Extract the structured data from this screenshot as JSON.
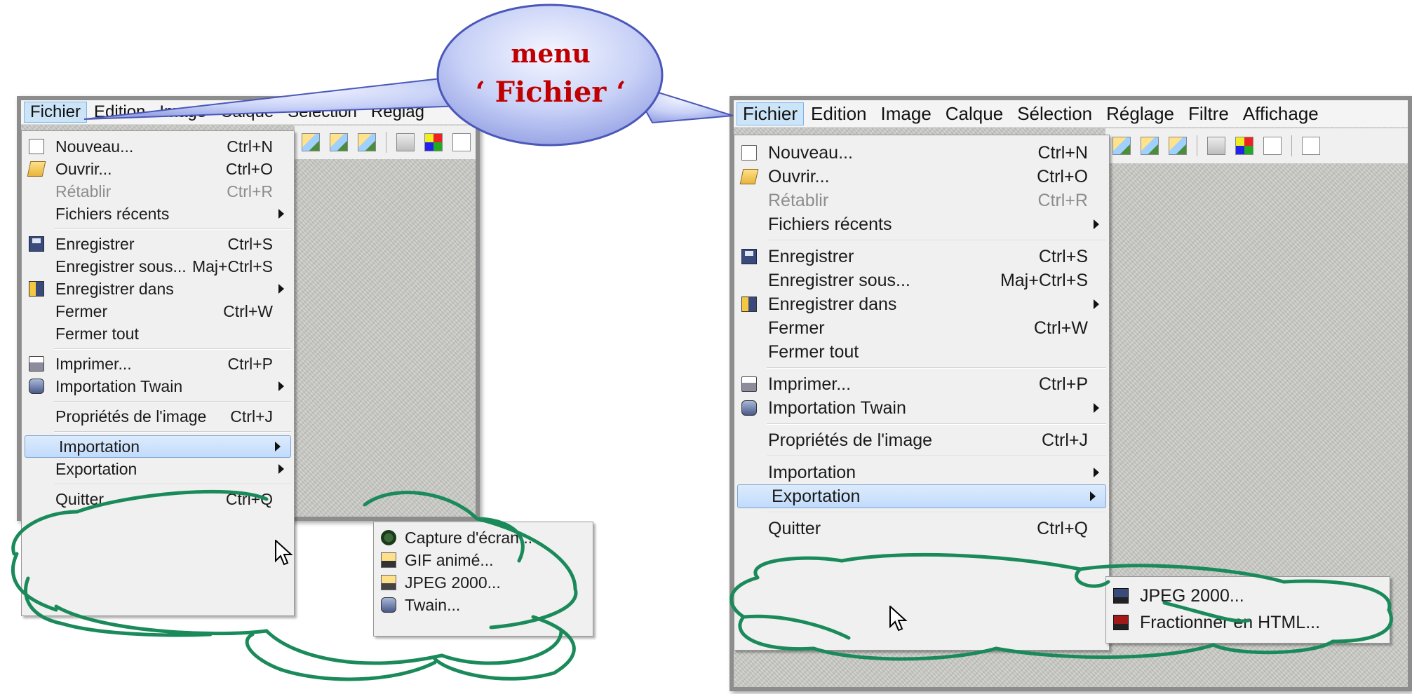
{
  "menubar": [
    "Fichier",
    "Edition",
    "Image",
    "Calque",
    "Sélection",
    "Réglage",
    "Filtre",
    "Affichage"
  ],
  "menubar_left_visible": [
    "Fichier",
    "Edition",
    "Image",
    "Calque",
    "Sélection",
    "Réglag"
  ],
  "callout": {
    "line1": "menu",
    "line2": "‘ Fichier ‘"
  },
  "file_menu": {
    "items": [
      {
        "label": "Nouveau...",
        "shortcut": "Ctrl+N",
        "icon": "new-document-icon"
      },
      {
        "label": "Ouvrir...",
        "shortcut": "Ctrl+O",
        "icon": "open-folder-icon"
      },
      {
        "label": "Rétablir",
        "shortcut": "Ctrl+R",
        "disabled": true
      },
      {
        "label": "Fichiers récents",
        "submenu": true
      },
      {
        "label": "Enregistrer",
        "shortcut": "Ctrl+S",
        "icon": "save-icon"
      },
      {
        "label": "Enregistrer sous...",
        "shortcut": "Maj+Ctrl+S"
      },
      {
        "label": "Enregistrer dans",
        "submenu": true,
        "icon": "save-in-icon"
      },
      {
        "label": "Fermer",
        "shortcut": "Ctrl+W"
      },
      {
        "label": "Fermer tout"
      },
      {
        "label": "Imprimer...",
        "shortcut": "Ctrl+P",
        "icon": "print-icon"
      },
      {
        "label": "Importation Twain",
        "submenu": true,
        "icon": "twain-icon"
      },
      {
        "label": "Propriétés de l'image",
        "shortcut": "Ctrl+J"
      },
      {
        "label": "Importation",
        "submenu": true
      },
      {
        "label": "Exportation",
        "submenu": true
      },
      {
        "label": "Quitter",
        "shortcut": "Ctrl+Q"
      }
    ]
  },
  "import_submenu": [
    {
      "label": "Capture d'écran...",
      "icon": "camera-icon"
    },
    {
      "label": "GIF animé...",
      "icon": "gif-folder-icon"
    },
    {
      "label": "JPEG 2000...",
      "icon": "jpeg2000-folder-icon"
    },
    {
      "label": "Twain...",
      "icon": "twain-icon"
    }
  ],
  "export_submenu": [
    {
      "label": "JPEG 2000...",
      "icon": "jpeg2000-save-icon"
    },
    {
      "label": "Fractionner en HTML...",
      "icon": "html-save-icon"
    }
  ],
  "colors": {
    "callout_text": "#c00000",
    "highlight_cloud": "#1a8a5a",
    "panel_frame": "#8d8d8d"
  }
}
